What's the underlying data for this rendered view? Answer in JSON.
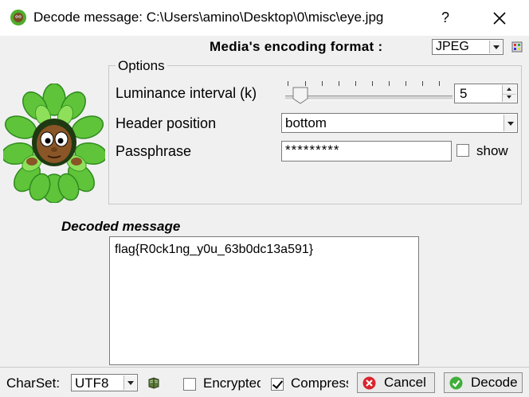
{
  "window": {
    "title": "Decode message: C:\\Users\\amino\\Desktop\\0\\misc\\eye.jpg",
    "help_glyph": "?",
    "close_glyph": "✕"
  },
  "format": {
    "label": "Media's encoding format :",
    "value": "JPEG"
  },
  "options": {
    "title": "Options",
    "luminance_label": "Luminance interval (k)",
    "luminance_value": "5",
    "header_label": "Header position",
    "header_value": "bottom",
    "passphrase_label": "Passphrase",
    "passphrase_value": "*********",
    "show_label": "show",
    "show_checked": false
  },
  "decoded": {
    "label": "Decoded message",
    "text": "flag{R0ck1ng_y0u_63b0dc13a591}"
  },
  "bottom": {
    "charset_label": "CharSet:",
    "charset_value": "UTF8",
    "encrypted_label": "Encrypted",
    "encrypted_checked": false,
    "compress_label": "Compress",
    "compress_checked": true,
    "cancel_label": "Cancel",
    "decode_label": "Decode"
  },
  "icons": {
    "app": "leaf-face-icon",
    "format_settings": "palette-icon",
    "charset_book": "book-icon",
    "cancel": "cancel-icon",
    "decode": "check-icon"
  },
  "colors": {
    "background": "#f0f0f0",
    "cancel_red": "#d9232d",
    "decode_green": "#3fae3a",
    "leaf_green": "#5fc43a"
  }
}
